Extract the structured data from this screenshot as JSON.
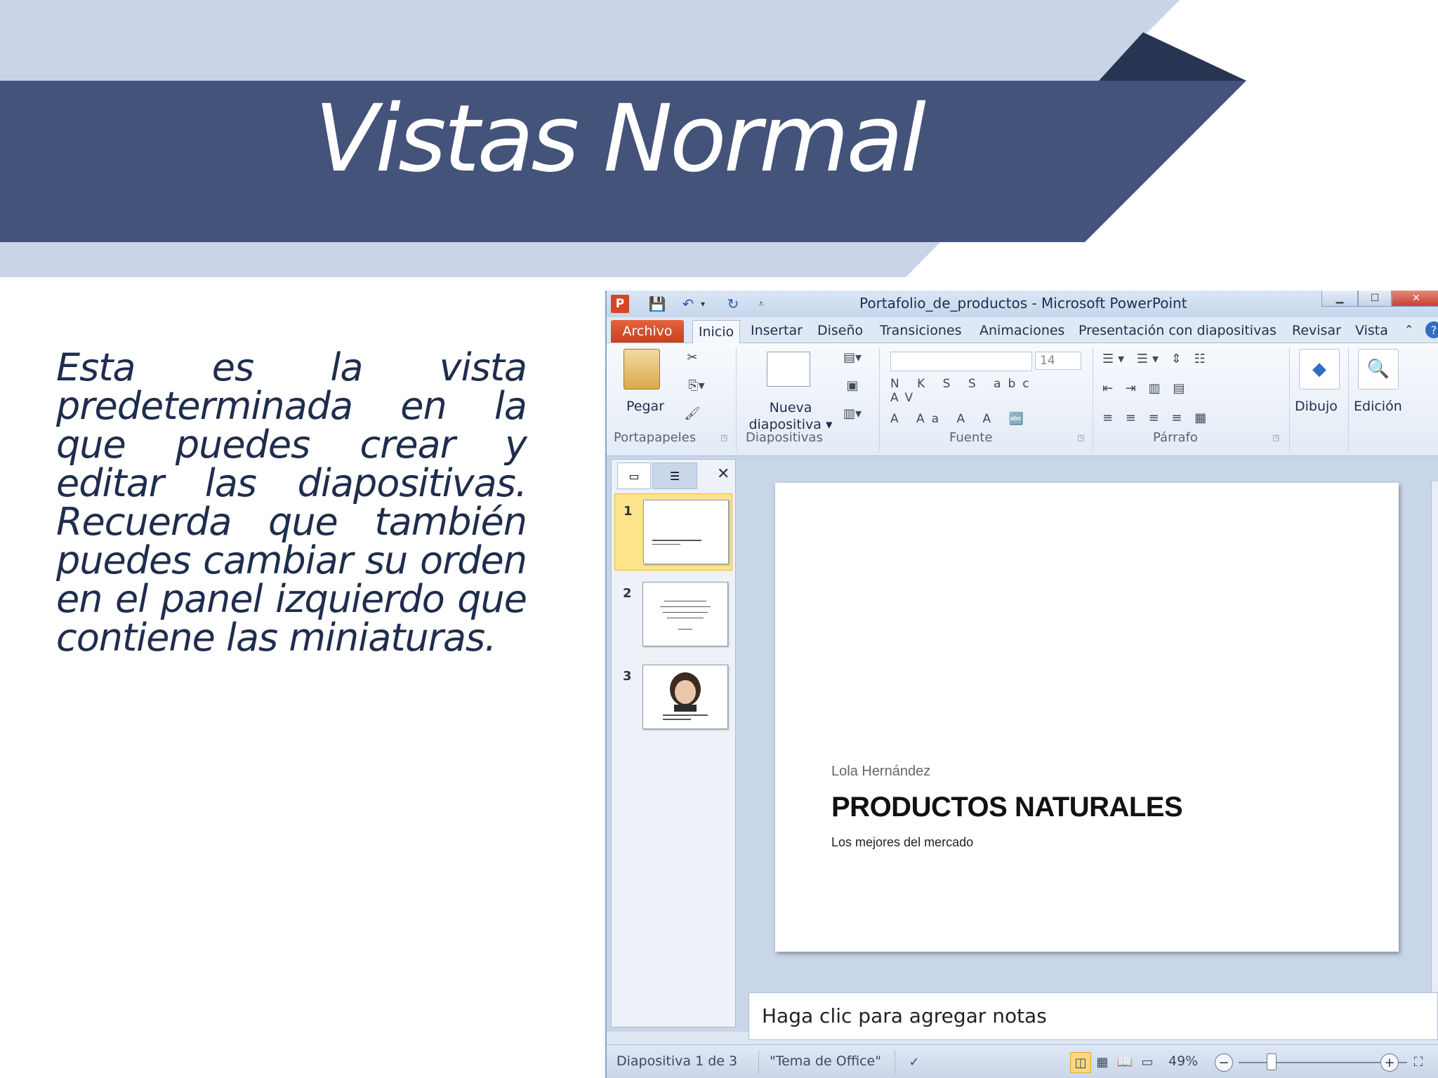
{
  "slide": {
    "title": "Vistas  Normal",
    "body": "Esta es la vista predeterminada en la que puedes crear y editar las diapositivas. Recuerda que también puedes cambiar su orden en el panel izquierdo que contiene las miniaturas."
  },
  "window": {
    "title": "Portafolio_de_productos - Microsoft PowerPoint",
    "app_icon": "P"
  },
  "tabs": {
    "file": "Archivo",
    "active": "Inicio",
    "items": [
      "Insertar",
      "Diseño",
      "Transiciones",
      "Animaciones",
      "Presentación con diapositivas",
      "Revisar",
      "Vista"
    ]
  },
  "ribbon": {
    "groups": [
      "Portapapeles",
      "Diapositivas",
      "Fuente",
      "Párrafo"
    ],
    "paste": "Pegar",
    "new_slide_line1": "Nueva",
    "new_slide_line2": "diapositiva",
    "font_size": "14",
    "drawing": "Dibujo",
    "editing": "Edición"
  },
  "thumbnails": [
    "1",
    "2",
    "3"
  ],
  "current_slide": {
    "author": "Lola Hernández",
    "heading": "PRODUCTOS NATURALES",
    "subtitle": "Los mejores del mercado"
  },
  "notes": {
    "placeholder": "Haga clic para agregar notas"
  },
  "status": {
    "slide_info": "Diapositiva 1 de 3",
    "theme": "\"Tema de Office\"",
    "zoom": "49%"
  },
  "colors": {
    "banner_dark": "#44537a",
    "banner_light": "#c9d4e8",
    "file_tab": "#d24726"
  }
}
